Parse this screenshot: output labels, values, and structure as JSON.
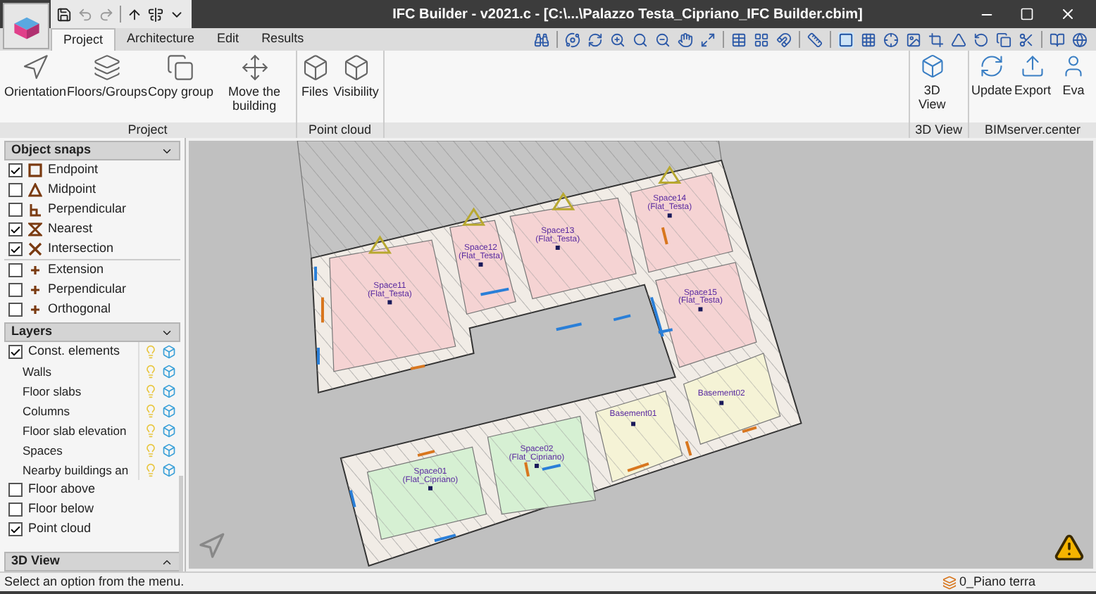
{
  "window": {
    "title": "IFC Builder - v2021.c - [C:\\...\\Palazzo Testa_Cipriano_IFC Builder.cbim]"
  },
  "tabs": [
    {
      "label": "Project",
      "selected": true
    },
    {
      "label": "Architecture",
      "selected": false
    },
    {
      "label": "Edit",
      "selected": false
    },
    {
      "label": "Results",
      "selected": false
    }
  ],
  "ribbon": {
    "groups": [
      {
        "label": "Project",
        "buttons": [
          "Orientation",
          "Floors/Groups",
          "Copy group",
          "Move the building"
        ]
      },
      {
        "label": "Point cloud",
        "buttons": [
          "Files",
          "Visibility"
        ]
      }
    ],
    "right_groups": [
      {
        "label": "3D View",
        "buttons": [
          "3D View"
        ]
      },
      {
        "label": "BIMserver.center",
        "buttons": [
          "Update",
          "Export",
          "Eva"
        ]
      }
    ]
  },
  "object_snaps": {
    "title": "Object snaps",
    "expanded": true,
    "groups": [
      [
        {
          "label": "Endpoint",
          "checked": true
        },
        {
          "label": "Midpoint",
          "checked": false
        },
        {
          "label": "Perpendicular",
          "checked": false
        },
        {
          "label": "Nearest",
          "checked": true
        },
        {
          "label": "Intersection",
          "checked": true
        }
      ],
      [
        {
          "label": "Extension",
          "checked": false
        },
        {
          "label": "Perpendicular",
          "checked": false
        },
        {
          "label": "Orthogonal",
          "checked": false
        }
      ]
    ]
  },
  "layers": {
    "title": "Layers",
    "expanded": true,
    "items": [
      {
        "label": "Const. elements",
        "checked": true,
        "children": [
          {
            "label": "Walls"
          },
          {
            "label": "Floor slabs"
          },
          {
            "label": "Columns"
          },
          {
            "label": "Floor slab elevation"
          },
          {
            "label": "Spaces"
          },
          {
            "label": "Nearby buildings an"
          }
        ]
      },
      {
        "label": "Floor above",
        "checked": false
      },
      {
        "label": "Floor below",
        "checked": false
      },
      {
        "label": "Point cloud",
        "checked": true
      }
    ]
  },
  "view_3d": {
    "title": "3D View",
    "expanded": false
  },
  "plan": {
    "rooms": [
      {
        "name": "Space11",
        "group": "(Flat_Testa)",
        "color": "#f5d3d3"
      },
      {
        "name": "Space12",
        "group": "(Flat_Testa)",
        "color": "#f5d3d3"
      },
      {
        "name": "Space13",
        "group": "(Flat_Testa)",
        "color": "#f5d3d3"
      },
      {
        "name": "Space14",
        "group": "(Flat_Testa)",
        "color": "#f5d3d3"
      },
      {
        "name": "Space15",
        "group": "(Flat_Testa)",
        "color": "#f5d3d3"
      },
      {
        "name": "Basement02",
        "color": "#f5f3d6"
      },
      {
        "name": "Basement01",
        "color": "#f5f3d6"
      },
      {
        "name": "Space02",
        "group": "(Flat_Cipriano)",
        "color": "#d6f0d3"
      },
      {
        "name": "Space01",
        "group": "(Flat_Cipriano)",
        "color": "#d6f0d3"
      }
    ]
  },
  "status_bar": {
    "message": "Select an option from the menu.",
    "floor": "0_Piano terra"
  }
}
